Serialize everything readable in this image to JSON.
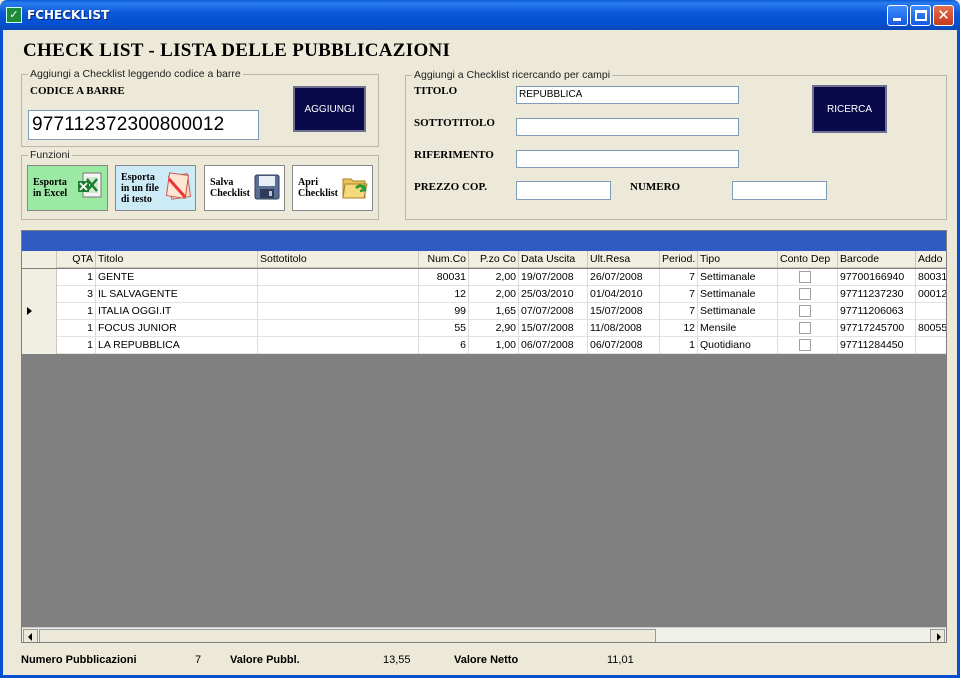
{
  "window": {
    "icon": "checklist-app-icon",
    "title": "FCHECKLIST"
  },
  "page_title": "CHECK LIST - LISTA DELLE PUBBLICAZIONI",
  "barcode_group": {
    "legend": "Aggiungi a Checklist leggendo codice a barre",
    "label": "CODICE A BARRE",
    "value": "977112372300800012",
    "add_button": "AGGIUNGI"
  },
  "functions_group": {
    "legend": "Funzioni",
    "buttons": [
      {
        "label": "Esporta\nin Excel",
        "icon": "excel-icon"
      },
      {
        "label": "Esporta\nin un file\ndi testo",
        "icon": "text-file-icon"
      },
      {
        "label": "Salva\nChecklist",
        "icon": "floppy-disk-icon"
      },
      {
        "label": "Apri\nChecklist",
        "icon": "open-folder-icon"
      }
    ]
  },
  "search_group": {
    "legend": "Aggiungi a Checklist ricercando per campi",
    "titolo_label": "TITOLO",
    "titolo_value": "REPUBBLICA",
    "sottotitolo_label": "SOTTOTITOLO",
    "sottotitolo_value": "",
    "riferimento_label": "RIFERIMENTO",
    "riferimento_value": "",
    "prezzo_label": "PREZZO COP.",
    "prezzo_value": "",
    "numero_label": "NUMERO",
    "numero_value": "",
    "search_button": "RICERCA"
  },
  "grid": {
    "columns": [
      "QTA",
      "Titolo",
      "Sottotitolo",
      "Num.Co",
      "P.zo Co",
      "Data Uscita",
      "Ult.Resa",
      "Period.",
      "Tipo",
      "Conto Dep",
      "Barcode",
      "Addo"
    ],
    "rows": [
      {
        "qta": "1",
        "titolo": "GENTE",
        "sottotitolo": "",
        "num": "80031",
        "prezzo": "2,00",
        "data": "19/07/2008",
        "resa": "26/07/2008",
        "period": "7",
        "tipo": "Settimanale",
        "conto": false,
        "barcode": "97700166940",
        "addo": "80031",
        "selected": false
      },
      {
        "qta": "3",
        "titolo": "IL SALVAGENTE",
        "sottotitolo": "",
        "num": "12",
        "prezzo": "2,00",
        "data": "25/03/2010",
        "resa": "01/04/2010",
        "period": "7",
        "tipo": "Settimanale",
        "conto": false,
        "barcode": "97711237230",
        "addo": "00012",
        "selected": false
      },
      {
        "qta": "1",
        "titolo": "ITALIA OGGI.IT",
        "sottotitolo": "",
        "num": "99",
        "prezzo": "1,65",
        "data": "07/07/2008",
        "resa": "15/07/2008",
        "period": "7",
        "tipo": "Settimanale",
        "conto": false,
        "barcode": "97711206063",
        "addo": "",
        "selected": true
      },
      {
        "qta": "1",
        "titolo": "FOCUS JUNIOR",
        "sottotitolo": "",
        "num": "55",
        "prezzo": "2,90",
        "data": "15/07/2008",
        "resa": "11/08/2008",
        "period": "12",
        "tipo": "Mensile",
        "conto": false,
        "barcode": "97717245700",
        "addo": "80055",
        "selected": false
      },
      {
        "qta": "1",
        "titolo": "LA REPUBBLICA",
        "sottotitolo": "",
        "num": "6",
        "prezzo": "1,00",
        "data": "06/07/2008",
        "resa": "06/07/2008",
        "period": "1",
        "tipo": "Quotidiano",
        "conto": false,
        "barcode": "97711284450",
        "addo": "",
        "selected": false
      }
    ]
  },
  "footer": {
    "num_pub_label": "Numero Pubblicazioni",
    "num_pub_value": "7",
    "valore_pubbl_label": "Valore Pubbl.",
    "valore_pubbl_value": "13,55",
    "valore_netto_label": "Valore Netto",
    "valore_netto_value": "11,01"
  }
}
